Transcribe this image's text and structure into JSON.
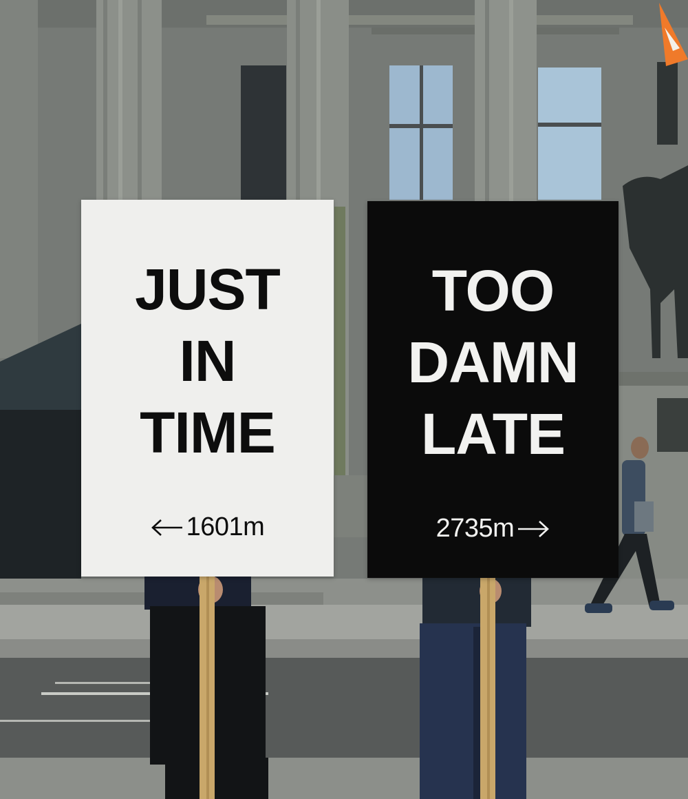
{
  "scene": {
    "description_icon": "street-protest-scene",
    "colors": {
      "building": "#7c807c",
      "column": "#8b8f89",
      "road": "#5a5c5b",
      "pavement": "#9a9c98",
      "sign_light": "#efefed",
      "sign_dark": "#0b0b0b",
      "cone": "#f07a2a"
    }
  },
  "signs": {
    "left": {
      "lines": [
        "JUST",
        "IN",
        "TIME"
      ],
      "distance": "1601m",
      "arrow_icon": "arrow-left-icon"
    },
    "right": {
      "lines": [
        "TOO",
        "DAMN",
        "LATE"
      ],
      "distance": "2735m",
      "arrow_icon": "arrow-right-icon"
    }
  }
}
